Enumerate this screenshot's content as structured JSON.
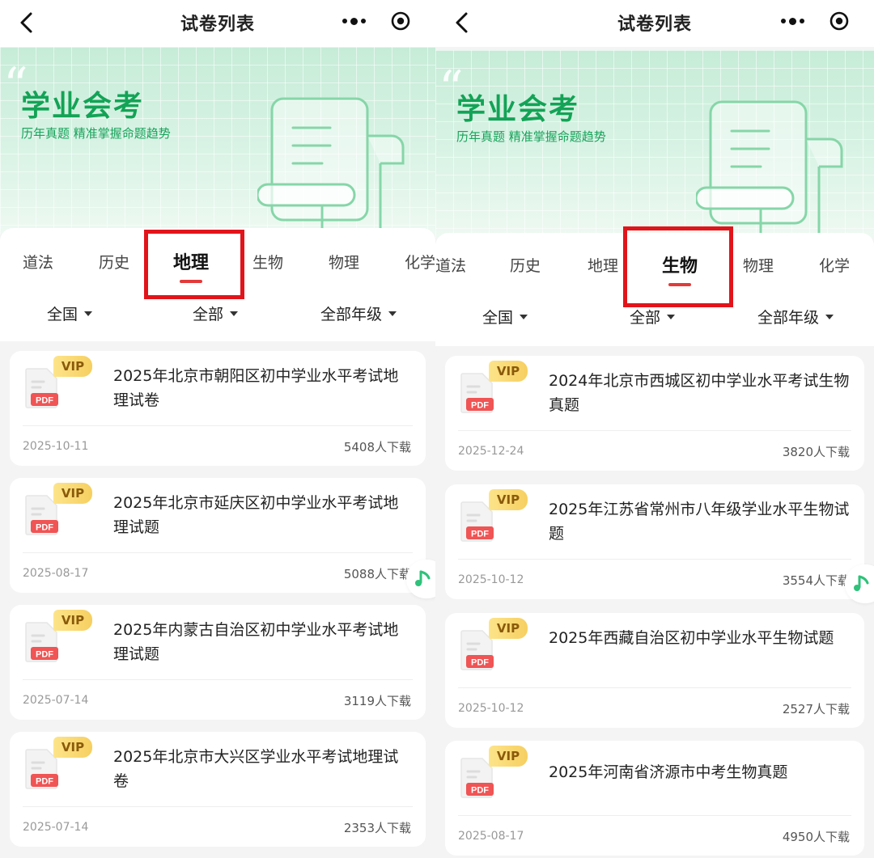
{
  "colors": {
    "accent_green": "#13a356",
    "tab_indicator": "#e23a3a",
    "highlight_box": "#e2141b",
    "vip_gold": "#f6cf60",
    "pdf_red": "#f05454"
  },
  "left": {
    "nav_title": "试卷列表",
    "banner": {
      "title": "学业会考",
      "subtitle": "历年真题 精准掌握命题趋势"
    },
    "tabs": [
      "道法",
      "历史",
      "地理",
      "生物",
      "物理",
      "化学"
    ],
    "active_tab": "地理",
    "filters": [
      "全国",
      "全部",
      "全部年级"
    ],
    "cards": [
      {
        "badge": "VIP",
        "file_type": "PDF",
        "title": "2025年北京市朝阳区初中学业水平考试地理试卷",
        "date": "2025-10-11",
        "downloads": "5408人下载"
      },
      {
        "badge": "VIP",
        "file_type": "PDF",
        "title": "2025年北京市延庆区初中学业水平考试地理试题",
        "date": "2025-08-17",
        "downloads": "5088人下载"
      },
      {
        "badge": "VIP",
        "file_type": "PDF",
        "title": "2025年内蒙古自治区初中学业水平考试地理试题",
        "date": "2025-07-14",
        "downloads": "3119人下载"
      },
      {
        "badge": "VIP",
        "file_type": "PDF",
        "title": "2025年北京市大兴区学业水平考试地理试卷",
        "date": "2025-07-14",
        "downloads": "2353人下载"
      }
    ]
  },
  "right": {
    "nav_title": "试卷列表",
    "banner": {
      "title": "学业会考",
      "subtitle": "历年真题 精准掌握命题趋势"
    },
    "tabs": [
      "道法",
      "历史",
      "地理",
      "生物",
      "物理",
      "化学"
    ],
    "active_tab": "生物",
    "filters": [
      "全国",
      "全部",
      "全部年级"
    ],
    "cards": [
      {
        "badge": "VIP",
        "file_type": "PDF",
        "title": "2024年北京市西城区初中学业水平考试生物真题",
        "date": "2025-12-24",
        "downloads": "3820人下载"
      },
      {
        "badge": "VIP",
        "file_type": "PDF",
        "title": "2025年江苏省常州市八年级学业水平生物试题",
        "date": "2025-10-12",
        "downloads": "3554人下载"
      },
      {
        "badge": "VIP",
        "file_type": "PDF",
        "title": "2025年西藏自治区初中学业水平生物试题",
        "date": "2025-10-12",
        "downloads": "2527人下载"
      },
      {
        "badge": "VIP",
        "file_type": "PDF",
        "title": "2025年河南省济源市中考生物真题",
        "date": "2025-08-17",
        "downloads": "4950人下载"
      }
    ]
  },
  "icons": {
    "back": "chevron-left-icon",
    "more": "more-dots-icon",
    "close": "target-icon",
    "file": "pdf-file-icon",
    "music": "music-note-icon",
    "filter_caret": "caret-down-icon"
  }
}
